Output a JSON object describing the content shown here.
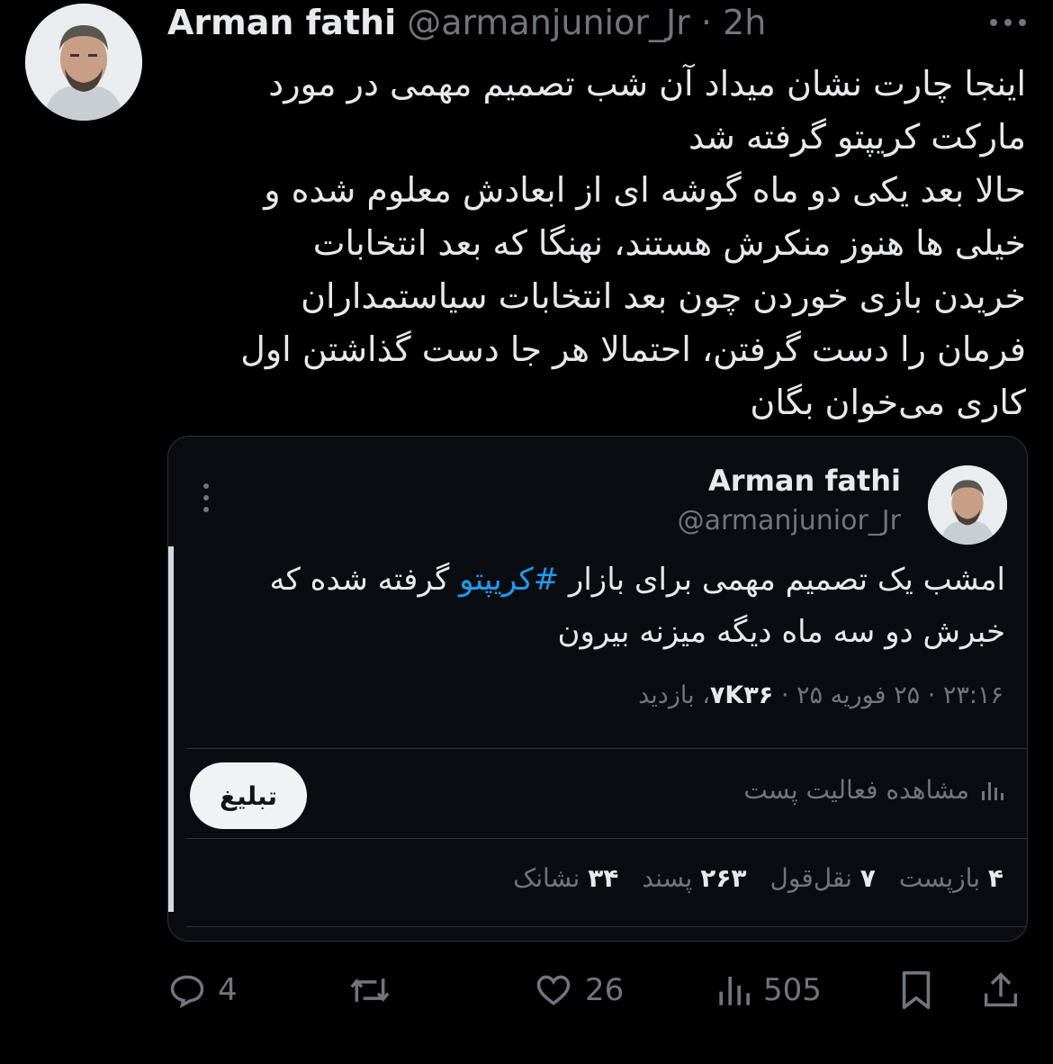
{
  "tweet": {
    "author_name": "Arman fathi",
    "author_handle": "@armanjunior_Jr",
    "separator": "·",
    "time_ago": "2h",
    "body_lines": [
      "اینجا چارت نشان میداد آن شب تصمیم مهمی در مورد",
      "مارکت کریپتو گرفته شد",
      "حالا بعد یکی دو ماه گوشه ای از ابعادش معلوم شده و",
      "خیلی ها هنوز منکرش هستند، نهنگا که بعد انتخابات",
      "خریدن بازی خوردن چون بعد انتخابات سیاستمداران",
      "فرمان را دست گرفتن، احتمالا هر جا دست گذاشتن اول",
      "کاری می‌خوان بگان"
    ],
    "actions": {
      "reply_count": "4",
      "like_count": "26",
      "view_count": "505"
    },
    "icons": [
      "more-icon",
      "reply-icon",
      "retweet-icon",
      "like-icon",
      "views-icon",
      "bookmark-icon",
      "share-icon"
    ]
  },
  "quoted": {
    "author_name": "Arman fathi",
    "author_handle": "@armanjunior_Jr",
    "text_before_hashtag": "امشب یک تصمیم مهمی برای بازار ",
    "hashtag": "#کریپتو",
    "text_after_hashtag": " گرفته شده که",
    "text_line2": "خبرش دو سه ماه دیگه میزنه بیرون",
    "meta_time": "۲۳:۱۶ · ۲۵ فوریه ۲۵ · ",
    "meta_views_value": "۷K۳۶",
    "meta_views_label": "، بازدید",
    "activity_label": "مشاهده فعالیت پست",
    "ad_button": "تبلیغ",
    "stats": {
      "reposts_value": "۴",
      "reposts_label": "بازپست",
      "quotes_value": "۷",
      "quotes_label": "نقل‌قول",
      "likes_value": "۲۶۳",
      "likes_label": "پسند",
      "bookmarks_value": "۳۴",
      "bookmarks_label": "نشانک"
    }
  },
  "colors": {
    "background": "#000000",
    "text": "#e7e9ea",
    "muted": "#71767b",
    "link": "#1d9bf0",
    "border": "#2f3336"
  }
}
